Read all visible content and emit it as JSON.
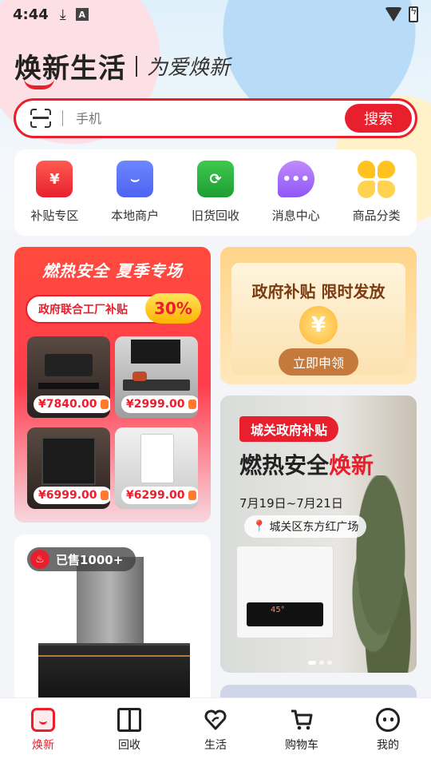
{
  "status_bar": {
    "time": "4:44",
    "icons": [
      "download-icon",
      "a-notification-icon",
      "wifi-icon",
      "battery-charging-icon"
    ]
  },
  "brand": {
    "name": "焕新生活",
    "slogan": "为爱焕新"
  },
  "search": {
    "placeholder": "手机",
    "button_label": "搜索"
  },
  "quick_entries": [
    {
      "label": "补贴专区",
      "icon": "red-envelope-icon",
      "glyph": "¥"
    },
    {
      "label": "本地商户",
      "icon": "store-smile-icon",
      "glyph": "⌣"
    },
    {
      "label": "旧货回收",
      "icon": "recycle-box-icon",
      "glyph": "⟳"
    },
    {
      "label": "消息中心",
      "icon": "chat-bubble-icon",
      "glyph": "•••"
    },
    {
      "label": "商品分类",
      "icon": "clover-category-icon",
      "glyph": ""
    }
  ],
  "promo_left": {
    "title": "燃热安全 夏季专场",
    "banner": "政府联合工厂补贴",
    "percent": "30%",
    "products": [
      {
        "price": "¥7840.00"
      },
      {
        "price": "¥2999.00"
      },
      {
        "price": "¥6999.00"
      },
      {
        "price": "¥6299.00"
      }
    ]
  },
  "promo_right_top": {
    "title": "政府补贴 限时发放",
    "coin": "¥",
    "button": "立即申领"
  },
  "promo_right_bottom": {
    "tag": "城关政府补贴",
    "title_part1": "燃热安全",
    "title_part2": "焕新",
    "date": "7月19日~7月21日",
    "location": "城关区东方红广场",
    "heater_display": "45°"
  },
  "product_card": {
    "sold": "已售1000+"
  },
  "bottom_nav": [
    {
      "label": "焕新",
      "icon": "home-smile-icon",
      "active": true
    },
    {
      "label": "回收",
      "icon": "book-icon",
      "active": false
    },
    {
      "label": "生活",
      "icon": "heart-leaf-icon",
      "active": false
    },
    {
      "label": "购物车",
      "icon": "cart-icon",
      "active": false
    },
    {
      "label": "我的",
      "icon": "profile-face-icon",
      "active": false
    }
  ],
  "colors": {
    "accent": "#e8202d",
    "gold": "#c57a3b"
  }
}
